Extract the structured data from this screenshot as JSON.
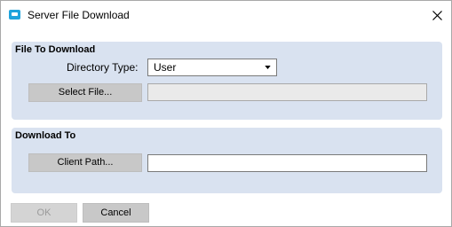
{
  "window": {
    "title": "Server File Download",
    "icon": "app-icon",
    "close_icon": "close-icon"
  },
  "file_to_download": {
    "title": "File To Download",
    "directory_type_label": "Directory Type:",
    "directory_type_value": "User",
    "select_file_label": "Select File...",
    "file_path_value": ""
  },
  "download_to": {
    "title": "Download To",
    "client_path_label": "Client Path...",
    "client_path_value": ""
  },
  "footer": {
    "ok_label": "OK",
    "cancel_label": "Cancel"
  },
  "colors": {
    "panel_bg": "#d9e2f0",
    "button_bg": "#c8c8c8",
    "disabled_text": "#9a9a9a",
    "icon_blue": "#1fa3dc"
  }
}
